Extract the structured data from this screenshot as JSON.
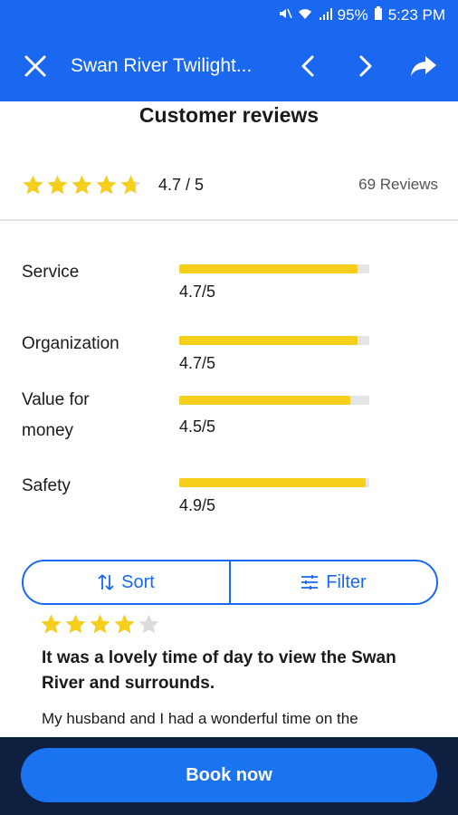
{
  "status_bar": {
    "battery": "95%",
    "time": "5:23 PM",
    "icons": [
      "mute-icon",
      "wifi-icon",
      "signal-icon",
      "battery-icon"
    ]
  },
  "app_bar": {
    "title": "Swan River Twilight...",
    "icons": [
      "close-icon",
      "chevron-left-icon",
      "chevron-right-icon",
      "share-icon"
    ]
  },
  "heading": "Customer reviews",
  "overall": {
    "rating": 4.7,
    "score_text": "4.7 / 5",
    "reviews_text": "69 Reviews"
  },
  "categories": [
    {
      "label": "Service",
      "value_text": "4.7/5",
      "value": 4.7
    },
    {
      "label": "Organization",
      "value_text": "4.7/5",
      "value": 4.7
    },
    {
      "label_lines": [
        "Value for",
        "money"
      ],
      "value_text": "4.5/5",
      "value": 4.5
    },
    {
      "label": "Safety",
      "value_text": "4.9/5",
      "value": 4.9
    }
  ],
  "controls": {
    "sort_label": "Sort",
    "filter_label": "Filter"
  },
  "review": {
    "rating": 4,
    "title": "It was a lovely time of day to view the Swan River and surrounds.",
    "text": "My husband and I had a wonderful time on the"
  },
  "cta": {
    "book_label": "Book now"
  },
  "colors": {
    "primary": "#1a68f0",
    "star": "#f6ce1c",
    "bottom_bar": "#0e1f40"
  }
}
